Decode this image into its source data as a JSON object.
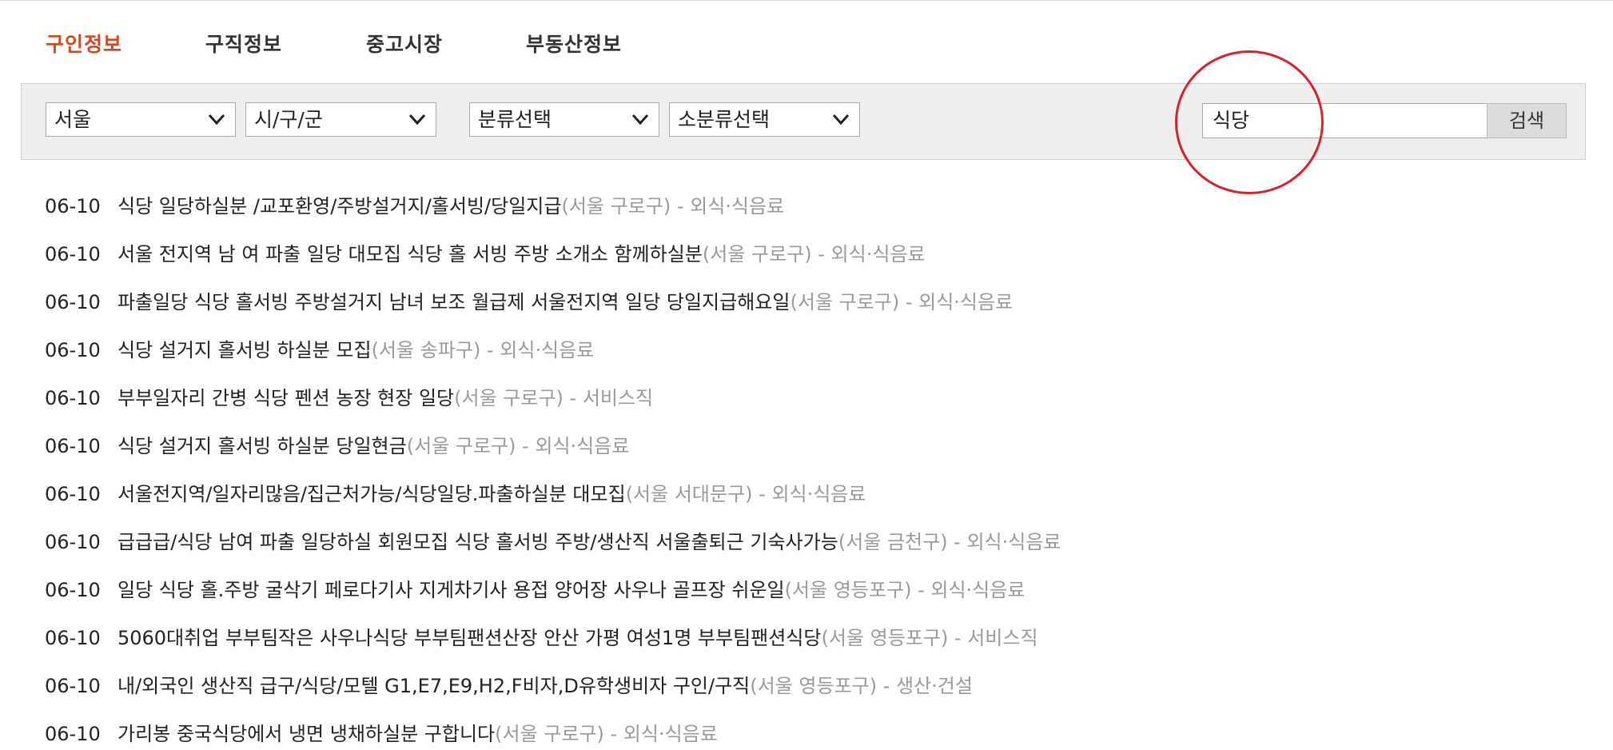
{
  "tabs": [
    {
      "label": "구인정보",
      "active": true
    },
    {
      "label": "구직정보",
      "active": false
    },
    {
      "label": "중고시장",
      "active": false
    },
    {
      "label": "부동산정보",
      "active": false
    }
  ],
  "filters": {
    "region": "서울",
    "district": "시/구/군",
    "category": "분류선택",
    "subcategory": "소분류선택"
  },
  "search": {
    "keyword": "식당",
    "button_label": "검색"
  },
  "colors": {
    "active_tab": "#cc4b24",
    "annotation_circle": "#d0252f",
    "meta_text": "#9a9a9a"
  },
  "listings": [
    {
      "date": "06-10",
      "title": "식당 일당하실분 /교포환영/주방설거지/홀서빙/당일지급",
      "meta": "(서울 구로구) - 외식·식음료"
    },
    {
      "date": "06-10",
      "title": "서울 전지역 남 여 파출 일당 대모집 식당 홀 서빙 주방 소개소 함께하실분",
      "meta": "(서울 구로구) - 외식·식음료"
    },
    {
      "date": "06-10",
      "title": "파출일당 식당 홀서빙 주방설거지 남녀 보조 월급제 서울전지역 일당 당일지급해요일",
      "meta": "(서울 구로구) - 외식·식음료"
    },
    {
      "date": "06-10",
      "title": "식당 설거지 홀서빙 하실분 모집",
      "meta": "(서울 송파구) - 외식·식음료"
    },
    {
      "date": "06-10",
      "title": "부부일자리 간병 식당 펜션 농장 현장 일당",
      "meta": "(서울 구로구) - 서비스직"
    },
    {
      "date": "06-10",
      "title": "식당 설거지 홀서빙 하실분 당일현금",
      "meta": "(서울 구로구) - 외식·식음료"
    },
    {
      "date": "06-10",
      "title": "서울전지역/일자리많음/집근처가능/식당일당.파출하실분 대모집",
      "meta": "(서울 서대문구) - 외식·식음료"
    },
    {
      "date": "06-10",
      "title": "급급급/식당 남여 파출 일당하실 회원모집 식당 홀서빙 주방/생산직 서울출퇴근 기숙사가능",
      "meta": "(서울 금천구) - 외식·식음료"
    },
    {
      "date": "06-10",
      "title": "일당 식당 홀.주방 굴삭기 페로다기사 지게차기사 용접 양어장 사우나 골프장 쉬운일",
      "meta": "(서울 영등포구) - 외식·식음료"
    },
    {
      "date": "06-10",
      "title": "5060대취업 부부팀작은 사우나식당 부부팀팬션산장 안산 가평 여성1명 부부팀팬션식당",
      "meta": "(서울 영등포구) - 서비스직"
    },
    {
      "date": "06-10",
      "title": "내/외국인 생산직 급구/식당/모텔 G1,E7,E9,H2,F비자,D유학생비자 구인/구직",
      "meta": "(서울 영등포구) - 생산·건설"
    },
    {
      "date": "06-10",
      "title": "가리봉 중국식당에서 냉면 냉채하실분 구합니다",
      "meta": "(서울 구로구) - 외식·식음료"
    }
  ]
}
